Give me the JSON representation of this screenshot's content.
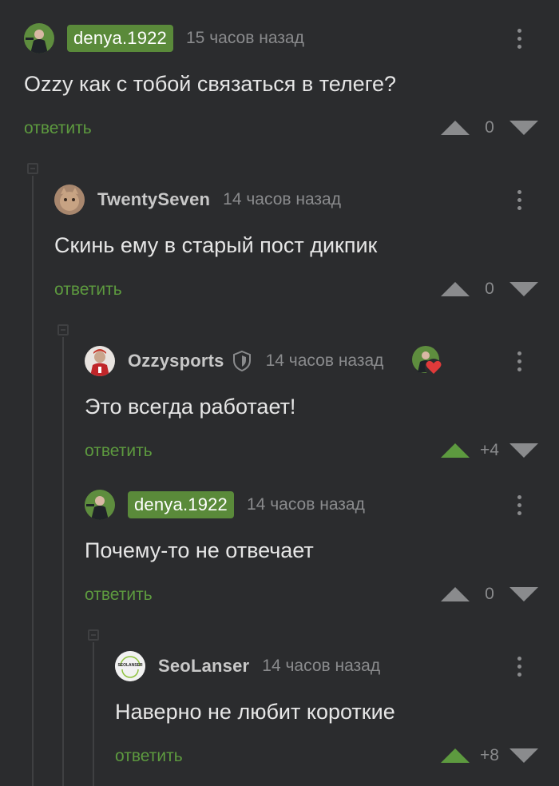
{
  "comments": [
    {
      "nick": "denya.1922",
      "time": "15 часов назад",
      "text": "Ozzy как с тобой связаться в телеге?",
      "reply": "ответить",
      "score": "0"
    },
    {
      "nick": "TwentySeven",
      "time": "14 часов назад",
      "text": "Скинь ему в старый пост дикпик",
      "reply": "ответить",
      "score": "0"
    },
    {
      "nick": "Ozzysports",
      "time": "14 часов назад",
      "text": "Это всегда работает!",
      "reply": "ответить",
      "score": "+4"
    },
    {
      "nick": "denya.1922",
      "time": "14 часов назад",
      "text": "Почему-то не отвечает",
      "reply": "ответить",
      "score": "0"
    },
    {
      "nick": "SeoLanser",
      "time": "14 часов назад",
      "text": "Наверно не любит короткие",
      "reply": "ответить",
      "score": "+8"
    }
  ],
  "seolanser_logo_text": "SEOLANSER",
  "colors": {
    "background": "#2b2c2e",
    "accent_green": "#5d9a3f",
    "op_badge": "#5a8a3a",
    "muted": "#8a8b8d"
  }
}
